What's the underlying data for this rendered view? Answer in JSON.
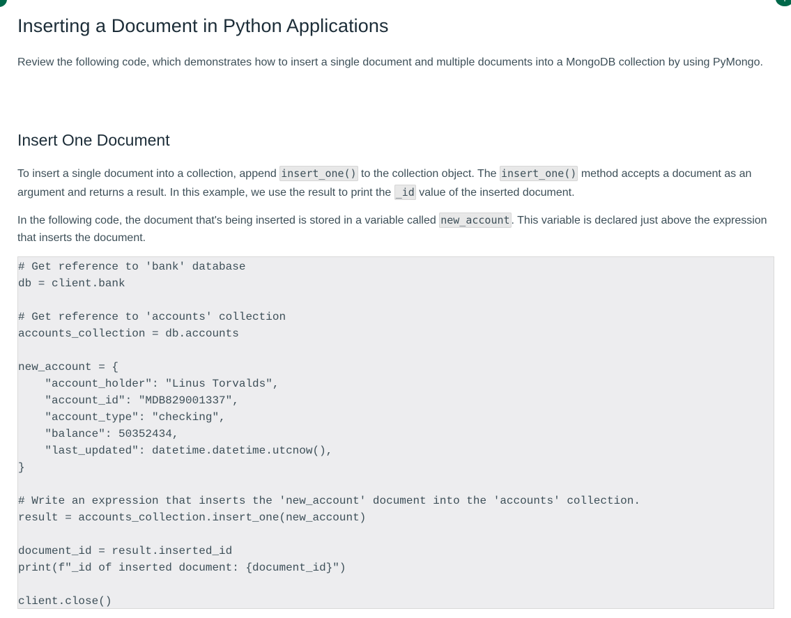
{
  "colors": {
    "accent": "#00684a",
    "heading": "#1c2d38",
    "body_text": "#3d4f58",
    "code_background": "#ededef"
  },
  "icons": {
    "top_right": "plus-icon"
  },
  "page": {
    "title": "Inserting a Document in Python Applications",
    "intro": "Review the following code, which demonstrates how to insert a single document and multiple documents into a MongoDB collection by using PyMongo."
  },
  "section": {
    "heading": "Insert One Document",
    "para1": {
      "t1": "To insert a single document into a collection, append ",
      "c1": "insert_one()",
      "t2": " to the collection object. The ",
      "c2": "insert_one()",
      "t3": " method accepts a document as an argument and returns a result. In this example, we use the result to print the ",
      "c3": "_id",
      "t4": " value of the inserted document."
    },
    "para2": {
      "t1": "In the following code, the document that's being inserted is stored in a variable called ",
      "c1": "new_account",
      "t2": ". This variable is declared just above the expression that inserts the document."
    },
    "code": "# Get reference to 'bank' database\ndb = client.bank\n\n# Get reference to 'accounts' collection\naccounts_collection = db.accounts\n\nnew_account = {\n    \"account_holder\": \"Linus Torvalds\",\n    \"account_id\": \"MDB829001337\",\n    \"account_type\": \"checking\",\n    \"balance\": 50352434,\n    \"last_updated\": datetime.datetime.utcnow(),\n}\n\n# Write an expression that inserts the 'new_account' document into the 'accounts' collection.\nresult = accounts_collection.insert_one(new_account)\n\ndocument_id = result.inserted_id\nprint(f\"_id of inserted document: {document_id}\")\n\nclient.close()"
  }
}
